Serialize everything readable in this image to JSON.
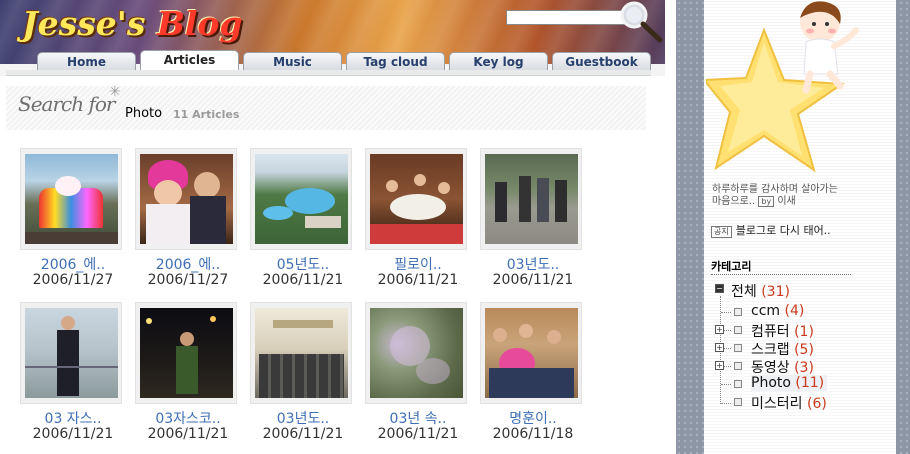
{
  "header": {
    "logo_part1": "Jesse's",
    "logo_part2": "Blog"
  },
  "tabs": [
    {
      "label": "Home",
      "active": false
    },
    {
      "label": "Articles",
      "active": true
    },
    {
      "label": "Music",
      "active": false
    },
    {
      "label": "Tag cloud",
      "active": false
    },
    {
      "label": "Key log",
      "active": false
    },
    {
      "label": "Guestbook",
      "active": false
    }
  ],
  "search": {
    "heading": "Search for",
    "query": "Photo",
    "count": "11 Articles"
  },
  "items": [
    {
      "title": "2006_에..",
      "date": "2006/11/27"
    },
    {
      "title": "2006_에..",
      "date": "2006/11/27"
    },
    {
      "title": "05년도..",
      "date": "2006/11/21"
    },
    {
      "title": "필로이..",
      "date": "2006/11/21"
    },
    {
      "title": "03년도..",
      "date": "2006/11/21"
    },
    {
      "title": "03 자스..",
      "date": "2006/11/21"
    },
    {
      "title": "03자스코..",
      "date": "2006/11/21"
    },
    {
      "title": "03년도..",
      "date": "2006/11/21"
    },
    {
      "title": "03년 속..",
      "date": "2006/11/21"
    },
    {
      "title": "명훈이..",
      "date": "2006/11/18"
    }
  ],
  "sidebar": {
    "intro_line1": "하루하루를 감사하며 살아가는",
    "intro_line2": "마음으로..",
    "intro_by_badge": "by",
    "intro_author": "이새",
    "notice_badge": "공지",
    "notice_text": "블로그로 다시 태어..",
    "category_title": "카테고리",
    "categories": [
      {
        "label": "전체",
        "count": "(31)"
      },
      {
        "label": "ccm",
        "count": "(4)"
      },
      {
        "label": "컴퓨터",
        "count": "(1)"
      },
      {
        "label": "스크랩",
        "count": "(5)"
      },
      {
        "label": "동영상",
        "count": "(3)"
      },
      {
        "label": "Photo",
        "count": "(11)"
      },
      {
        "label": "미스터리",
        "count": "(6)"
      }
    ]
  }
}
